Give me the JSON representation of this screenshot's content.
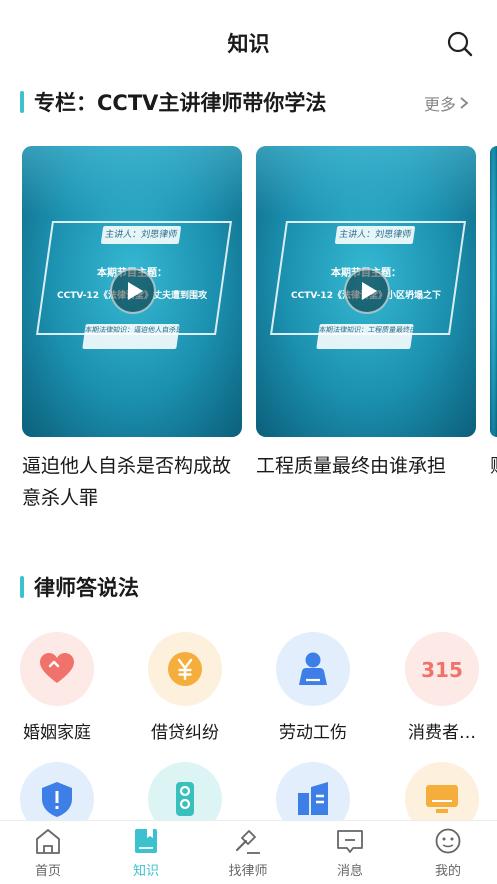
{
  "header": {
    "title": "知识"
  },
  "column_section": {
    "title": "专栏：CCTV主讲律师带你学法",
    "more_label": "更多"
  },
  "videos": [
    {
      "host": "主讲人：刘思律师",
      "slide_heading": "本期节目主题：",
      "slide_text": "CCTV-12《法律讲堂》丈夫遭到围攻",
      "note": "本期法律知识：逼迫他人自杀是否构成故意杀人罪",
      "caption": "逼迫他人自杀是否构成故意杀人罪"
    },
    {
      "host": "主讲人：刘思律师",
      "slide_heading": "本期节目主题：",
      "slide_text": "CCTV-12《法律讲堂》小区坍塌之下",
      "note": "本期法律知识：工程质量最终由谁承担",
      "caption": "工程质量最终由谁承担"
    },
    {
      "caption": "赠 ... 权"
    }
  ],
  "lawyer_section": {
    "title": "律师答说法"
  },
  "categories": [
    {
      "label": "婚姻家庭",
      "icon": "heart-icon",
      "bg": "#fde9e6",
      "fg": "#f0736b"
    },
    {
      "label": "借贷纠纷",
      "icon": "yen-coin-icon",
      "bg": "#fdf0dc",
      "fg": "#f5ad3b"
    },
    {
      "label": "劳动工伤",
      "icon": "worker-icon",
      "bg": "#e3eefc",
      "fg": "#3d7fe6"
    },
    {
      "label": "消费者…",
      "icon": "315-icon",
      "bg": "#fde9e6",
      "fg": "#f0736b"
    },
    {
      "label": "",
      "icon": "shield-icon",
      "bg": "#e3eefc",
      "fg": "#3d7fe6"
    },
    {
      "label": "",
      "icon": "traffic-light-icon",
      "bg": "#dcf5f4",
      "fg": "#39c0bd"
    },
    {
      "label": "",
      "icon": "building-icon",
      "bg": "#e3eefc",
      "fg": "#3d7fe6"
    },
    {
      "label": "",
      "icon": "monitor-icon",
      "bg": "#fdf0dc",
      "fg": "#f5ad3b"
    }
  ],
  "nav": [
    {
      "label": "首页",
      "icon": "home-icon"
    },
    {
      "label": "知识",
      "icon": "book-icon",
      "active": true
    },
    {
      "label": "找律师",
      "icon": "gavel-icon"
    },
    {
      "label": "消息",
      "icon": "message-icon"
    },
    {
      "label": "我的",
      "icon": "profile-icon"
    }
  ],
  "colors": {
    "accent": "#3cc2cf",
    "text": "#1a1a1a",
    "muted": "#888888"
  }
}
